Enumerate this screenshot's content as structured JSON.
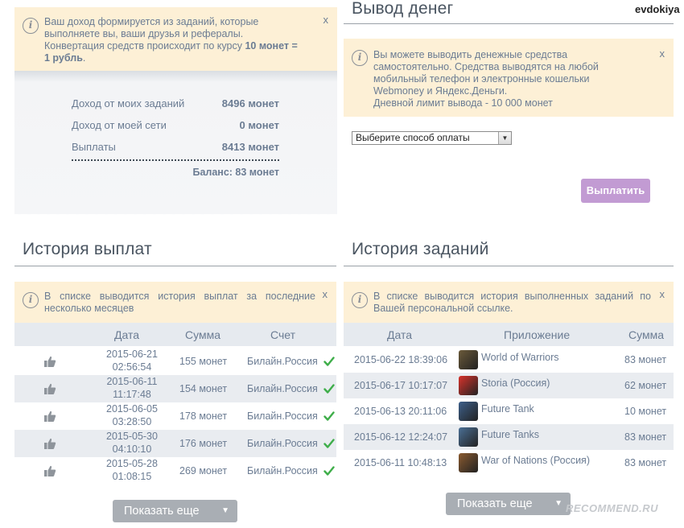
{
  "top": {
    "username": "evdokiya"
  },
  "income": {
    "notice": {
      "line1": "Ваш доход формируется из заданий, которые",
      "line2": "выполняете вы, ваши друзья и рефералы.",
      "line3_pre": "Конвертация средств происходит по курсу ",
      "line3_bold": "10 монет =",
      "line4_bold": "1 рубль",
      "line4_post": ".",
      "close": "x"
    },
    "rows": [
      {
        "label": "Доход от моих заданий",
        "value": "8496 монет"
      },
      {
        "label": "Доход от моей сети",
        "value": "0 монет"
      },
      {
        "label": "Выплаты",
        "value": "8413 монет"
      }
    ],
    "balance": "Баланс: 83 монет"
  },
  "withdraw": {
    "title": "Вывод денег",
    "notice": {
      "line1": "Вы можете выводить денежные средства",
      "line2": "самостоятельно. Средства выводятся на любой",
      "line3": "мобильный телефон и электронные кошельки",
      "line4": "Webmoney и Яндекс.Деньги.",
      "line5": "Дневной лимит вывода - 10 000 монет",
      "close": "x"
    },
    "select_value": "Выберите способ оплаты",
    "pay_button": "Выплатить"
  },
  "payments": {
    "title": "История выплат",
    "notice": {
      "line1": "В списке выводится история выплат за последние",
      "line2": "несколько месяцев",
      "close": "x"
    },
    "headers": {
      "date": "Дата",
      "sum": "Сумма",
      "account": "Счет"
    },
    "rows": [
      {
        "date": "2015-06-21",
        "time": "02:56:54",
        "sum": "155 монет",
        "account": "Билайн.Россия"
      },
      {
        "date": "2015-06-11",
        "time": "11:17:48",
        "sum": "154 монет",
        "account": "Билайн.Россия"
      },
      {
        "date": "2015-06-05",
        "time": "03:28:50",
        "sum": "178 монет",
        "account": "Билайн.Россия"
      },
      {
        "date": "2015-05-30",
        "time": "04:10:10",
        "sum": "176 монет",
        "account": "Билайн.Россия"
      },
      {
        "date": "2015-05-28",
        "time": "01:08:15",
        "sum": "269 монет",
        "account": "Билайн.Россия"
      }
    ],
    "more_button": "Показать еще"
  },
  "tasks": {
    "title": "История заданий",
    "notice": {
      "line1": "В списке выводится история выполненных заданий по",
      "line2": "Вашей персональной ссылке.",
      "close": "x"
    },
    "headers": {
      "date": "Дата",
      "app": "Приложение",
      "sum": "Сумма"
    },
    "rows": [
      {
        "date": "2015-06-22 18:39:06",
        "app": "World of Warriors",
        "sum": "83 монет",
        "icon": "warrior-game-icon",
        "color": "#6b5a3a"
      },
      {
        "date": "2015-06-17 10:17:07",
        "app": "Storia (Россия)",
        "sum": "62 монет",
        "icon": "storia-app-icon",
        "color": "#d8322b"
      },
      {
        "date": "2015-06-13 20:11:06",
        "app": "Future Tank",
        "sum": "10 монет",
        "icon": "tank-game-icon",
        "color": "#3d5f8a"
      },
      {
        "date": "2015-06-12 12:24:07",
        "app": "Future Tanks",
        "sum": "83 монет",
        "icon": "tank-game-icon",
        "color": "#4a6f95"
      },
      {
        "date": "2015-06-11 10:48:13",
        "app": "War of Nations (Россия)",
        "sum": "83 монет",
        "icon": "nations-game-icon",
        "color": "#8a5a2f"
      }
    ],
    "more_button": "Показать еще"
  },
  "watermark": "RECOMMEND.RU",
  "colors": {
    "notice_bg": "#fdf0d6",
    "row_alt": "#e9ecf0",
    "pay_button": "#c29bd3",
    "check_green": "#3fae4a",
    "more_button": "#a9aeb4"
  }
}
